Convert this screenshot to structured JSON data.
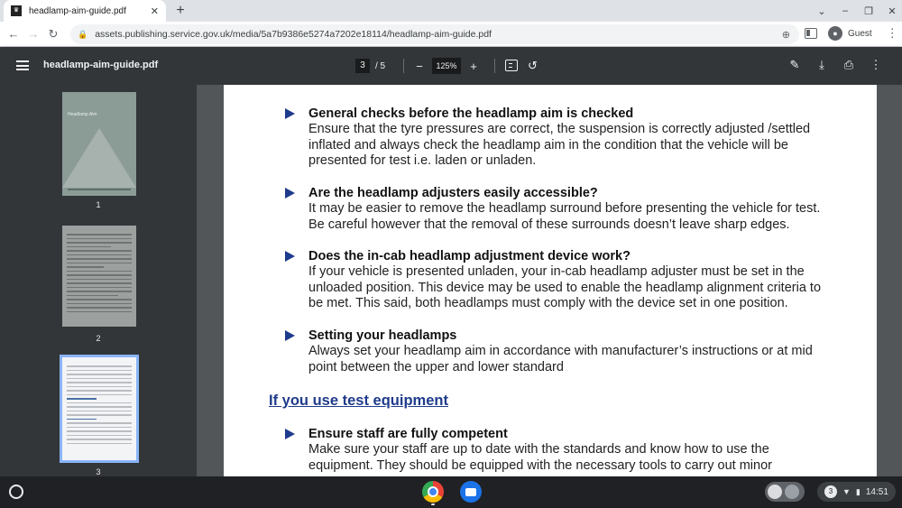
{
  "browser": {
    "tab_title": "headlamp-aim-guide.pdf",
    "tab_close": "✕",
    "new_tab": "+",
    "url": "assets.publishing.service.gov.uk/media/5a7b9386e5274a7202e18114/headlamp-aim-guide.pdf",
    "profile_label": "Guest"
  },
  "pdf_toolbar": {
    "title": "headlamp-aim-guide.pdf",
    "current_page": "3",
    "page_separator": "/ 5",
    "zoom": "125%"
  },
  "thumbnails": {
    "cover_title": "Headlamp Aim",
    "pages": [
      "1",
      "2",
      "3"
    ],
    "selected_page": "3"
  },
  "document": {
    "items": [
      {
        "heading": "General checks before the headlamp aim is checked",
        "body": "Ensure that the tyre pressures are correct, the suspension is correctly adjusted /settled inflated and always check the headlamp aim in the condition that the vehicle will be presented for test i.e. laden or unladen."
      },
      {
        "heading": "Are the headlamp adjusters easily accessible?",
        "body": "It may be easier to remove the headlamp surround before presenting the vehicle for test. Be careful however that the removal of these surrounds doesn’t leave sharp edges."
      },
      {
        "heading": "Does the in-cab headlamp adjustment device work?",
        "body": "If your vehicle is presented unladen, your in-cab headlamp adjuster must be set in the unloaded position. This device may be used to enable the headlamp alignment criteria to be met. This said, both headlamps must comply with the device set in one position."
      },
      {
        "heading": "Setting your headlamps",
        "body": "Always set your headlamp aim in accordance with manufacturer’s instructions or at mid point between the upper and lower standard"
      }
    ],
    "section_heading": "If you use test equipment",
    "item5": {
      "heading": "Ensure staff are fully competent",
      "body": "Make sure your staff are up to date with the standards and know how to use the equipment. They should be equipped with the necessary tools to carry out minor"
    }
  },
  "shelf": {
    "notification_count": "3",
    "time": "14:51"
  },
  "colors": {
    "accent_blue": "#1f3b8c",
    "viewer_bg": "#525659",
    "toolbar_bg": "#323639"
  }
}
